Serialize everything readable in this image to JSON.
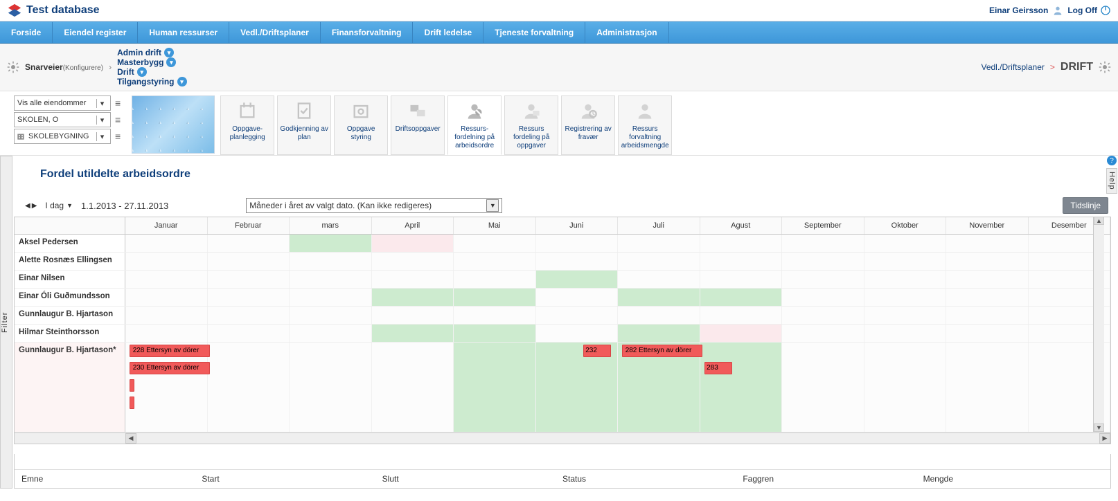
{
  "header": {
    "title": "Test database",
    "user": "Einar Geirsson",
    "logoff": "Log Off"
  },
  "main_menu": [
    "Forside",
    "Eiendel register",
    "Human ressurser",
    "Vedl./Driftsplaner",
    "Finansforvaltning",
    "Drift ledelse",
    "Tjeneste forvaltning",
    "Administrasjon"
  ],
  "shortcuts": {
    "label": "Snarveier",
    "configure": "(Konfigurere)",
    "items": [
      "Admin drift",
      "Masterbygg",
      "Drift",
      "Tilgangstyring"
    ],
    "breadcrumb_module": "Vedl./Driftsplaner",
    "breadcrumb_sep": ">",
    "breadcrumb_current": "DRIFT"
  },
  "filters": {
    "select1": "Vis alle eiendommer",
    "select2": "SKOLEN, O",
    "select3": "SKOLEBYGNING"
  },
  "ribbon": [
    {
      "label": "Oppgave-\nplanlegging"
    },
    {
      "label": "Godkjenning av\nplan"
    },
    {
      "label": "Oppgave\nstyring"
    },
    {
      "label": "Driftsoppgaver"
    },
    {
      "label": "Ressurs-\nfordelning på\narbeidsordre",
      "active": true
    },
    {
      "label": "Ressurs\nfordeling på\noppgaver"
    },
    {
      "label": "Registrering av\nfravær"
    },
    {
      "label": "Ressurs\nforvaltning\narbeidsmengde"
    }
  ],
  "page": {
    "title": "Fordel utildelte arbeidsordre"
  },
  "filter_tab": "Filter",
  "help_tab": "Help",
  "timeline": {
    "today": "I dag",
    "range": "1.1.2013 - 27.11.2013",
    "view_select": "Måneder i året av valgt dato. (Kan ikke redigeres)",
    "button": "Tidslinje",
    "months": [
      "Januar",
      "Februar",
      "mars",
      "April",
      "Mai",
      "Juni",
      "Juli",
      "Agust",
      "September",
      "Oktober",
      "November",
      "Desember"
    ],
    "rows": [
      {
        "name": "Aksel Pedersen",
        "bg": [
          null,
          null,
          "green",
          "pink",
          null,
          null,
          null,
          null,
          null,
          null,
          null,
          null
        ]
      },
      {
        "name": "Alette Rosnæs Ellingsen",
        "bg": [
          null,
          null,
          null,
          null,
          null,
          null,
          null,
          null,
          null,
          null,
          null,
          null
        ]
      },
      {
        "name": "Einar Nilsen",
        "bg": [
          null,
          null,
          null,
          null,
          null,
          "green",
          null,
          null,
          null,
          null,
          null,
          null
        ]
      },
      {
        "name": "Einar Óli Guðmundsson",
        "bg": [
          null,
          null,
          null,
          "green",
          "green",
          null,
          "green",
          "green",
          null,
          null,
          null,
          null
        ]
      },
      {
        "name": "Gunnlaugur B. Hjartason",
        "bg": [
          null,
          null,
          null,
          null,
          null,
          null,
          null,
          null,
          null,
          null,
          null,
          null
        ]
      },
      {
        "name": "Hilmar Steinthorsson",
        "bg": [
          null,
          null,
          null,
          "green",
          "green",
          null,
          "green",
          "pink",
          null,
          null,
          null,
          null
        ]
      }
    ],
    "task_row": {
      "name": "Gunnlaugur B. Hjartason*",
      "bg_green_cols": [
        4,
        5,
        6,
        7
      ],
      "tasks_line1": [
        {
          "label": "228 Ettersyn av dörer",
          "left_pct": 0.4,
          "width_pct": 8.2
        },
        {
          "label": "232",
          "left_pct": 46.5,
          "width_pct": 2.8
        },
        {
          "label": "282 Ettersyn av dörer",
          "left_pct": 50.4,
          "width_pct": 8.2
        }
      ],
      "tasks_line2": [
        {
          "label": "230 Ettersyn av dörer",
          "left_pct": 0.4,
          "width_pct": 8.2
        },
        {
          "label": "283",
          "left_pct": 58.8,
          "width_pct": 2.8
        }
      ],
      "tasks_line3": [
        {
          "label": "",
          "left_pct": 0.4,
          "width_pct": 0.5
        }
      ],
      "tasks_line4": [
        {
          "label": "",
          "left_pct": 0.4,
          "width_pct": 0.5
        }
      ]
    }
  },
  "bottom_headers": [
    "Emne",
    "Start",
    "Slutt",
    "Status",
    "Faggren",
    "Mengde"
  ]
}
